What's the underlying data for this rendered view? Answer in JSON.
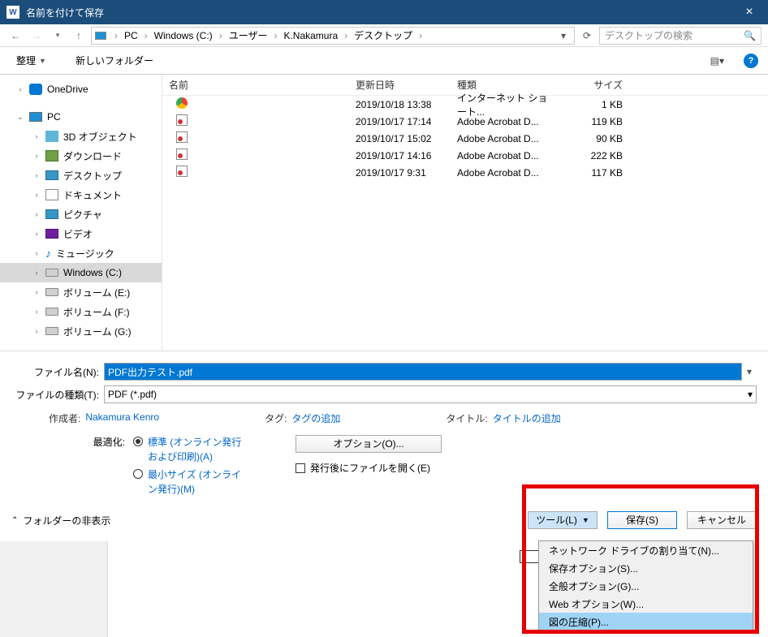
{
  "titlebar": {
    "title": "名前を付けて保存"
  },
  "breadcrumb": {
    "items": [
      "PC",
      "Windows (C:)",
      "ユーザー",
      "K.Nakamura",
      "デスクトップ"
    ]
  },
  "search": {
    "placeholder": "デスクトップの検索"
  },
  "toolbar": {
    "organize": "整理",
    "new_folder": "新しいフォルダー"
  },
  "navpane": {
    "onedrive": "OneDrive",
    "pc": "PC",
    "children": [
      "3D オブジェクト",
      "ダウンロード",
      "デスクトップ",
      "ドキュメント",
      "ピクチャ",
      "ビデオ",
      "ミュージック",
      "Windows (C:)",
      "ボリューム (E:)",
      "ボリューム (F:)",
      "ボリューム (G:)"
    ]
  },
  "columns": {
    "name": "名前",
    "date": "更新日時",
    "type": "種類",
    "size": "サイズ"
  },
  "files": [
    {
      "name": "",
      "date": "2019/10/18 13:38",
      "type": "インターネット ショート...",
      "size": "1 KB",
      "kind": "chrome"
    },
    {
      "name": "",
      "date": "2019/10/17 17:14",
      "type": "Adobe Acrobat D...",
      "size": "119 KB",
      "kind": "pdf"
    },
    {
      "name": "",
      "date": "2019/10/17 15:02",
      "type": "Adobe Acrobat D...",
      "size": "90 KB",
      "kind": "pdf"
    },
    {
      "name": "",
      "date": "2019/10/17 14:16",
      "type": "Adobe Acrobat D...",
      "size": "222 KB",
      "kind": "pdf"
    },
    {
      "name": "",
      "date": "2019/10/17 9:31",
      "type": "Adobe Acrobat D...",
      "size": "117 KB",
      "kind": "pdf"
    }
  ],
  "form": {
    "filename_label": "ファイル名(N):",
    "filename_value": "PDF出力テスト.pdf",
    "filetype_label": "ファイルの種類(T):",
    "filetype_value": "PDF (*.pdf)"
  },
  "meta": {
    "author_label": "作成者:",
    "author_value": "Nakamura Kenro",
    "tag_label": "タグ:",
    "tag_value": "タグの追加",
    "title_label": "タイトル:",
    "title_value": "タイトルの追加"
  },
  "optimize": {
    "label": "最適化:",
    "standard": "標準 (オンライン発行および印刷)(A)",
    "minimum": "最小サイズ (オンライン発行)(M)"
  },
  "options_btn": "オプション(O)...",
  "open_after": "発行後にファイルを開く(E)",
  "footer": {
    "hide_folders": "フォルダーの非表示",
    "tools": "ツール(L)",
    "save": "保存(S)",
    "cancel": "キャンセル"
  },
  "dropdown": [
    "ネットワーク ドライブの割り当て(N)...",
    "保存オプション(S)...",
    "全般オプション(G)...",
    "Web オプション(W)...",
    "図の圧縮(P)..."
  ]
}
